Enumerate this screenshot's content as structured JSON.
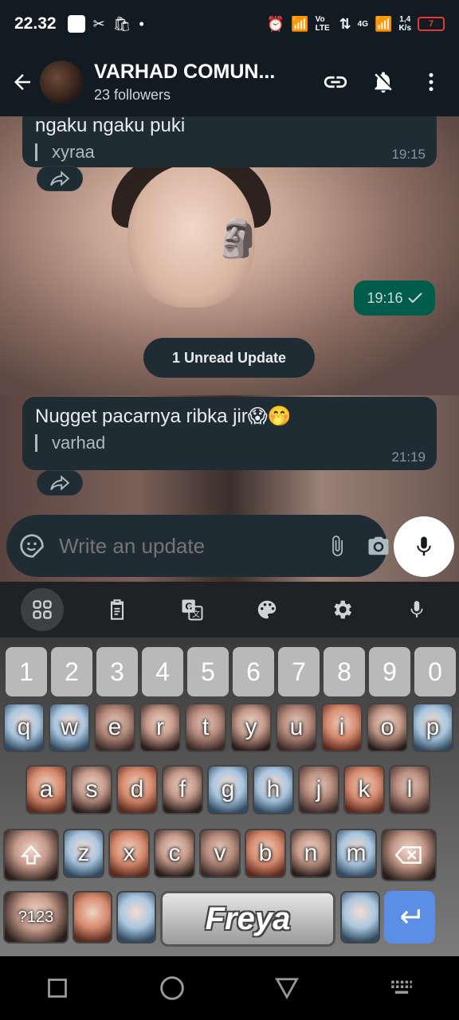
{
  "status_bar": {
    "time": "22.32",
    "net_speed_value": "1,4",
    "net_speed_unit": "K/s",
    "battery": "7",
    "signal_label": "Vo LTE",
    "network_type": "4G"
  },
  "header": {
    "channel_name": "VARHAD COMUN...",
    "followers": "23 followers"
  },
  "messages": [
    {
      "text": "ngaku ngaku puki",
      "signature": "xyraa",
      "time": "19:15"
    },
    {
      "text": "Nugget pacarnya ribka jir😱🤭",
      "signature": "varhad",
      "time": "21:19"
    }
  ],
  "outgoing": {
    "time": "19:16"
  },
  "unread_pill": "1 Unread Update",
  "input": {
    "placeholder": "Write an update"
  },
  "keyboard": {
    "numbers": [
      "1",
      "2",
      "3",
      "4",
      "5",
      "6",
      "7",
      "8",
      "9",
      "0"
    ],
    "row1": [
      "q",
      "w",
      "e",
      "r",
      "t",
      "y",
      "u",
      "i",
      "o",
      "p"
    ],
    "row2": [
      "a",
      "s",
      "d",
      "f",
      "g",
      "h",
      "j",
      "k",
      "l"
    ],
    "row3": [
      "z",
      "x",
      "c",
      "v",
      "b",
      "n",
      "m"
    ],
    "symbols_label": "?123",
    "space_label": "Freya"
  },
  "colors": {
    "bubble": "#1f2c34",
    "outgoing_bubble": "#005c4b",
    "header_bg": "#121b22",
    "enter_key": "#5b8fe6"
  }
}
